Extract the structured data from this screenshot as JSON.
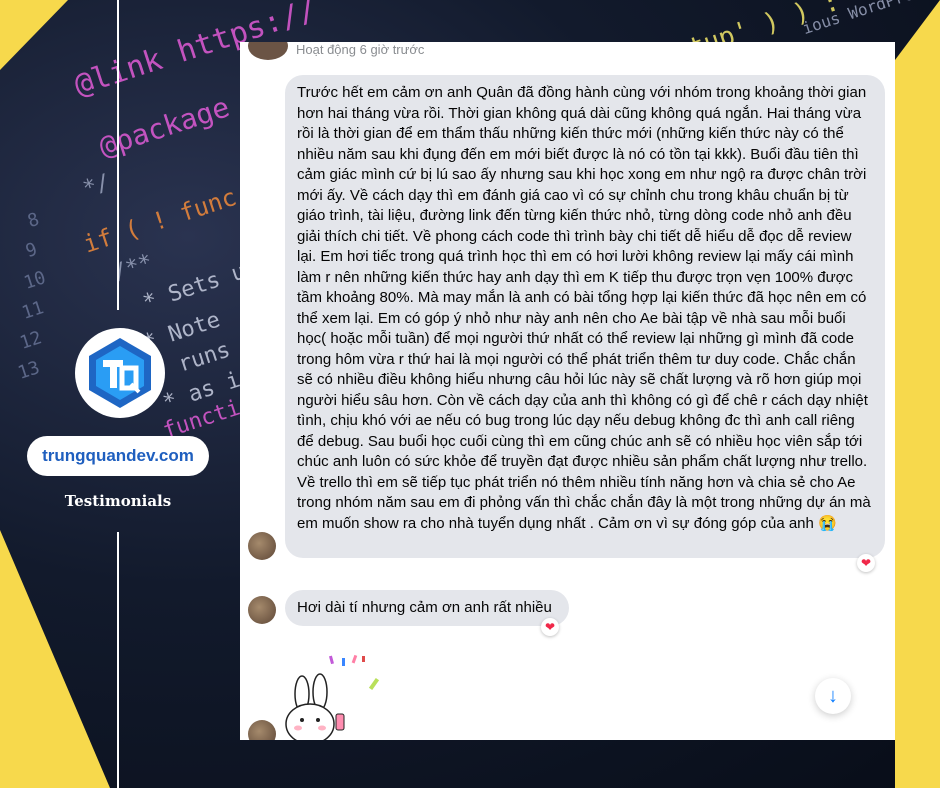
{
  "background": {
    "code_lines": [
      {
        "text": "@link https://",
        "color": "#e05bd6"
      },
      {
        "text": "@package",
        "color": "#e05bd6"
      },
      {
        "text": "*/",
        "color": "#9aa3bd"
      },
      {
        "text": "if ( ! func",
        "color": "#f08a3a"
      },
      {
        "text": "/**",
        "color": "#9aa3bd"
      },
      {
        "text": "* Sets up",
        "color": "#c7cde0"
      },
      {
        "text": "* Note",
        "color": "#c7cde0"
      },
      {
        "text": "* runs",
        "color": "#c7cde0"
      },
      {
        "text": "* as i",
        "color": "#c7cde0"
      },
      {
        "text": "functio",
        "color": "#e05bd6"
      }
    ],
    "code_right": [
      {
        "text": "etup' ) ) :",
        "color": "#f3e86a"
      },
      {
        "text": "ious WordPre",
        "color": "#9aa3bd"
      }
    ],
    "line_numbers": [
      "8",
      "9",
      "10",
      "11",
      "12",
      "13"
    ]
  },
  "brand": {
    "logo_name": "TQ",
    "site": "trungquandev.com",
    "tagline": "Testimonials",
    "accent": "#2a9df4",
    "yellow": "#f7d94c"
  },
  "chat": {
    "status": "Hoạt động 6 giờ trước",
    "messages": [
      {
        "text": "Trước hết em cảm ơn anh Quân đã đồng hành cùng với nhóm trong khoảng thời gian hơn hai tháng vừa rồi. Thời gian không quá dài cũng không quá ngắn. Hai tháng vừa rồi là thời gian để em thẩm thấu những kiến thức mới (những kiến thức này có thể nhiều năm sau khi đụng đến em mới biết được là nó có tồn tại kkk). Buổi đầu tiên thì cảm giác mình cứ bị lú sao ấy nhưng sau khi học xong em như ngộ ra được chân trời mới ấy. Về cách dạy thì em đánh giá cao vì có sự chỉnh chu trong khâu chuẩn bị từ giáo trình, tài liệu, đường link đến từng kiến thức nhỏ, từng dòng code nhỏ anh đều giải thích chi tiết. Về phong cách code thì trình bày chi tiết dễ hiểu dễ đọc dễ review lại. Em hơi tiếc trong quá trình học thì em có hơi lười không review lại mấy cái mình làm r nên những kiến thức hay anh dạy thì em K tiếp thu được trọn vẹn 100% được tầm khoảng 80%. Mà may mắn là anh có bài tổng hợp lại kiến thức đã học nên em có thể xem lại. Em có góp ý nhỏ như này anh nên cho Ae bài tập về nhà sau mỗi buổi học( hoặc mỗi tuần) để mọi người thứ nhất có thể review lại những gì mình đã code trong hôm vừa r thứ hai là mọi người có thể phát triển thêm tư duy code. Chắc chắn sẽ có nhiều điều không hiểu nhưng câu hỏi lúc này sẽ chất lượng và rõ hơn giúp mọi người hiểu sâu hơn. Còn về cách dạy của anh thì không có gì để chê r cách dạy nhiệt tình, chịu khó với ae nếu có bug trong lúc dạy nếu debug không đc thì anh call riêng để debug. Sau buổi học cuối cùng thì em cũng chúc anh sẽ có nhiều học viên sắp tới chúc anh luôn có sức khỏe để truyền đạt được nhiều sản phẩm chất lượng như trello. Về trello thì em sẽ tiếp tục phát triển nó thêm nhiều tính năng hơn và chia sẻ cho Ae trong nhóm năm sau em đi phỏng vấn thì chắc chắn đây là một trong những dự án mà em muốn show ra cho nhà tuyển dụng nhất . Cảm ơn vì sự đóng góp của anh 😭",
        "reaction": "❤"
      },
      {
        "text": "Hơi dài tí nhưng cảm ơn anh rất nhiều",
        "reaction": "❤"
      }
    ],
    "scroll_icon": "↓"
  }
}
